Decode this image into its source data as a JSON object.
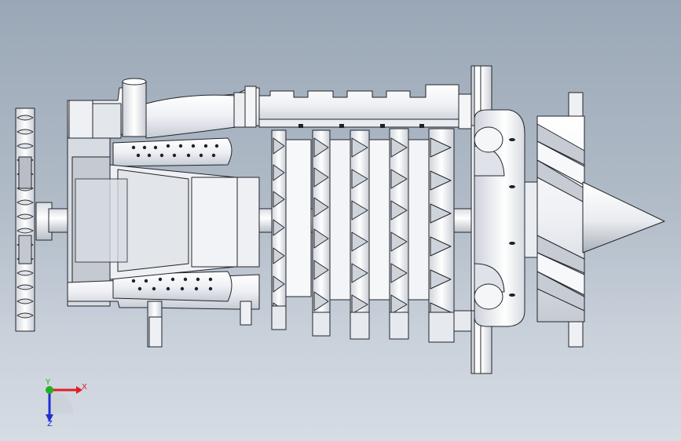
{
  "viewport": {
    "background_top": "#9aa7b6",
    "background_bottom": "#d6dce4",
    "model_fill": "#f4f5f7",
    "model_shade": "#c9ced6",
    "edge_color": "#22252b"
  },
  "triad": {
    "x_label": "X",
    "y_label": "Y",
    "z_label": "Z",
    "x_color": "#e02020",
    "y_color": "#20b020",
    "z_color": "#2030d0"
  },
  "model": {
    "description_icon": "jet-engine-section-model"
  }
}
